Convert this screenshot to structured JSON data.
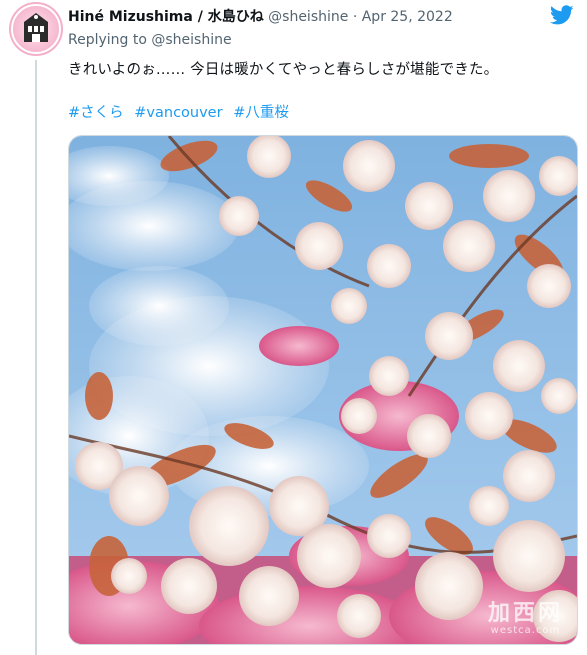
{
  "tweet": {
    "display_name": "Hiné Mizushima / 水島ひね",
    "handle": "@sheishine",
    "separator": "·",
    "date": "Apr 25, 2022",
    "replying_prefix": "Replying to",
    "replying_handle": "@sheishine",
    "text": "きれいよのぉ…… 今日は暖かくてやっと春らしさが堪能できた。",
    "hashtags": [
      "#さくら",
      "#vancouver",
      "#八重桜"
    ]
  },
  "media": {
    "description_icon": "cherry-blossom-photo",
    "watermark_cn": "加西网",
    "watermark_url": "westca.com"
  },
  "colors": {
    "link": "#1d9bf0",
    "text": "#0f1419",
    "muted": "#536471",
    "twitter": "#1d9bf0"
  }
}
